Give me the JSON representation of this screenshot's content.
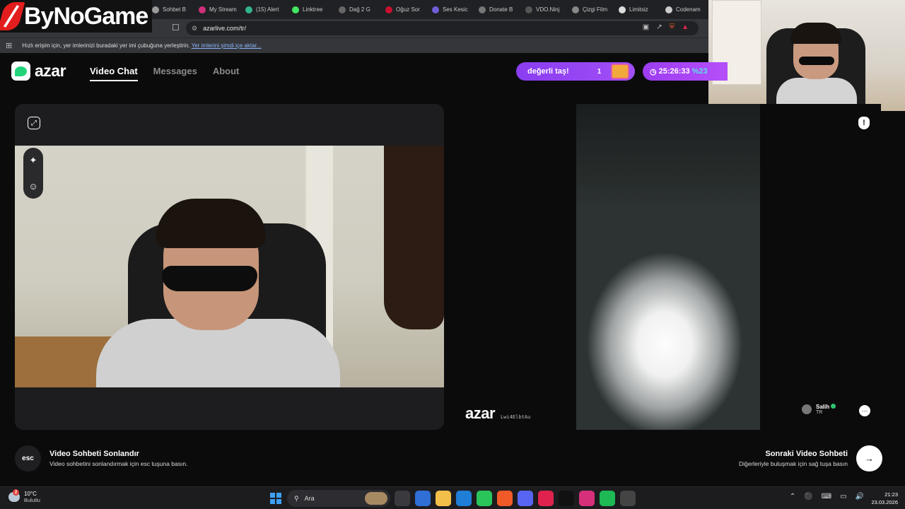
{
  "overlay": {
    "brand": "ByNoGame"
  },
  "browser": {
    "tabs": [
      {
        "label": "Sohbet B",
        "color": "#9a9a9a"
      },
      {
        "label": "My Stream",
        "color": "#d0307a"
      },
      {
        "label": "(15) Alert",
        "color": "#33b58c"
      },
      {
        "label": "Linktree",
        "color": "#43e660"
      },
      {
        "label": "Dağ 2 G",
        "color": "#666666"
      },
      {
        "label": "Oğuz Sor",
        "color": "#c8102e"
      },
      {
        "label": "Ses Kesic",
        "color": "#6e5fd6"
      },
      {
        "label": "Donate B",
        "color": "#777777"
      },
      {
        "label": "VDO.Ninj",
        "color": "#555555"
      },
      {
        "label": "Çizgi Film",
        "color": "#888888"
      },
      {
        "label": "Limitsiz",
        "color": "#dddddd"
      },
      {
        "label": "Codenam",
        "color": "#cccccc"
      }
    ],
    "url": "azarlive.com/tr/",
    "bookmarks_hint": "Hızlı erişim için, yer imlerinizi buradaki yer imi çubuğuna yerleştirin.",
    "bookmarks_link": "Yer imlerini şimdi içe aktar..."
  },
  "azar": {
    "logo": "azar",
    "nav": [
      "Video Chat",
      "Messages",
      "About"
    ],
    "promo_text": "değerli taş!",
    "promo_count": "1",
    "timer": "25:26:33",
    "timer_pct": "%23"
  },
  "peer": {
    "watermark": "azar",
    "code": "Lwi4ElbtAu",
    "name": "Salih",
    "country": "TR"
  },
  "controls": {
    "esc_key": "esc",
    "end_title": "Video Sohbeti Sonlandır",
    "end_desc": "Video sohbetini sonlandırmak için esc tuşuna basın.",
    "next_title": "Sonraki Video Sohbeti",
    "next_desc": "Diğerleriyle buluşmak için sağ tuşa basın",
    "next_key": "→"
  },
  "taskbar": {
    "temp": "10°C",
    "weather": "Bulutlu",
    "weather_badge": "2",
    "search": "Ara",
    "time": "21:23",
    "date": "23.03.2026",
    "apps": [
      {
        "name": "task-view",
        "color": "#3a3a3e"
      },
      {
        "name": "store",
        "color": "#2f6fd6"
      },
      {
        "name": "file-explorer",
        "color": "#f2c04a"
      },
      {
        "name": "outlook",
        "color": "#1f7ed6"
      },
      {
        "name": "whatsapp",
        "color": "#29c55b"
      },
      {
        "name": "brave",
        "color": "#f05a28"
      },
      {
        "name": "discord",
        "color": "#5865f2"
      },
      {
        "name": "opera",
        "color": "#e0234e"
      },
      {
        "name": "tiktok",
        "color": "#111111"
      },
      {
        "name": "instagram",
        "color": "#d6307a"
      },
      {
        "name": "spotify",
        "color": "#1db954"
      },
      {
        "name": "obs",
        "color": "#444444"
      }
    ]
  }
}
